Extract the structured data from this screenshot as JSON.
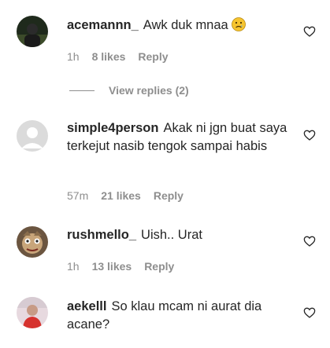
{
  "comments": [
    {
      "username": "acemannn_",
      "text": "Awk duk mnaa",
      "emoji": "sad-face-emoji",
      "time": "1h",
      "likes": "8 likes",
      "reply": "Reply"
    },
    {
      "username": "simple4person",
      "text": "Akak ni jgn buat saya terkejut nasib tengok sampai habis",
      "time": "57m",
      "likes": "21 likes",
      "reply": "Reply"
    },
    {
      "username": "rushmello_",
      "text": "Uish.. Urat",
      "time": "1h",
      "likes": "13 likes",
      "reply": "Reply"
    },
    {
      "username": "aekelll",
      "text": "So klau mcam ni aurat dia acane?",
      "time": "",
      "likes": "",
      "reply": ""
    }
  ],
  "view_replies": "View replies (2)",
  "icons": {
    "like": "heart-outline-icon"
  },
  "colors": {
    "text": "#262626",
    "meta": "#8e8e8e"
  }
}
